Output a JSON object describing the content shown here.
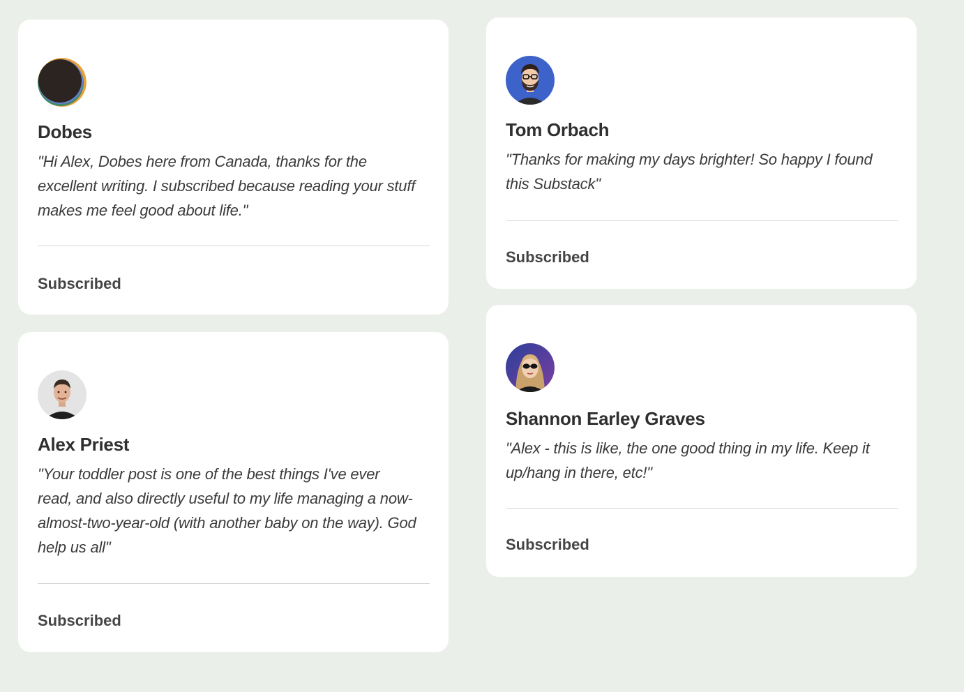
{
  "testimonials": [
    {
      "name": "Dobes",
      "avatar": "dark-circle-avatar",
      "quote": "\"Hi Alex, Dobes here from Canada, thanks for the excellent writing. I subscribed because reading your stuff makes me feel good about life.\"",
      "status": "Subscribed"
    },
    {
      "name": "Alex Priest",
      "avatar": "man-portrait-avatar",
      "quote": "\"Your toddler post is one of the best things I've ever read, and also directly useful to my life managing a now-almost-two-year-old (with another baby on the way). God help us all\"",
      "status": "Subscribed"
    },
    {
      "name": "Tom Orbach",
      "avatar": "bearded-man-cartoon-avatar",
      "quote": "\"Thanks for making my days brighter! So happy I found this Substack\"",
      "status": "Subscribed"
    },
    {
      "name": "Shannon Earley Graves",
      "avatar": "woman-sunglasses-avatar",
      "quote": "\"Alex - this is like, the one good thing in my life. Keep it up/hang in there, etc!\"",
      "status": "Subscribed"
    }
  ],
  "colors": {
    "page_background": "#ebefe9",
    "card_background": "#ffffff",
    "name_text": "#2f2f2f",
    "quote_text": "#3b3b3b",
    "divider": "#d6d6d6"
  }
}
